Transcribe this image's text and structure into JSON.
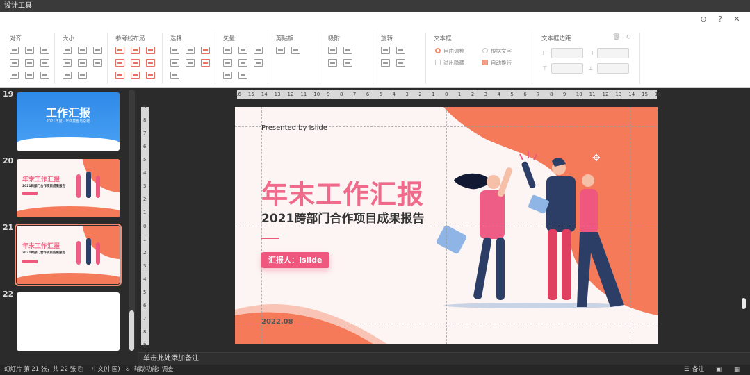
{
  "window": {
    "title": "设计工具"
  },
  "ribbon": {
    "groups": [
      {
        "label": "对齐"
      },
      {
        "label": "大小"
      },
      {
        "label": "参考线布局"
      },
      {
        "label": "选择"
      },
      {
        "label": "矢量"
      },
      {
        "label": "剪贴板"
      },
      {
        "label": "吸附"
      },
      {
        "label": "旋转"
      },
      {
        "label": "文本框"
      },
      {
        "label": "文本框边距"
      }
    ],
    "textbox": {
      "auto_adjust": "自由调整",
      "fit_text": "根据文字",
      "overflow_hide": "溢出隐藏",
      "auto_wrap": "自动换行"
    },
    "icons": {
      "settings": "settings-icon",
      "help": "help-icon",
      "close": "close-icon"
    }
  },
  "thumbnails": [
    {
      "number": "19",
      "title": "工作汇报",
      "subtitle": "2021年度 · 年终复盘与总结"
    },
    {
      "number": "20",
      "title": "年末工作汇报",
      "subtitle": "2021跨部门合作项目成果报告"
    },
    {
      "number": "21",
      "title": "年末工作汇报",
      "subtitle": "2021跨部门合作项目成果报告",
      "selected": true
    },
    {
      "number": "22"
    }
  ],
  "ruler": {
    "h_labels": [
      "16",
      "15",
      "14",
      "13",
      "12",
      "11",
      "10",
      "9",
      "8",
      "7",
      "6",
      "5",
      "4",
      "3",
      "2",
      "1",
      "0",
      "1",
      "2",
      "3",
      "4",
      "5",
      "6",
      "7",
      "8",
      "9",
      "10",
      "11",
      "12",
      "13",
      "14",
      "15",
      "16"
    ],
    "v_labels": [
      "9",
      "8",
      "7",
      "6",
      "5",
      "4",
      "3",
      "2",
      "1",
      "0",
      "1",
      "2",
      "3",
      "4",
      "5",
      "6",
      "7",
      "8",
      "9"
    ]
  },
  "slide": {
    "presented_by": "Presented by Islide",
    "title": "年末工作汇报",
    "subtitle": "2021跨部门合作项目成果报告",
    "reporter": "汇报人：Islide",
    "date": "2022.08",
    "colors": {
      "accent": "#f0577e",
      "coral": "#f57a5a",
      "background": "#fdf5f3"
    }
  },
  "notes": {
    "placeholder": "单击此处添加备注"
  },
  "status": {
    "slide_count": "幻灯片 第 21 张，共 22 张",
    "language": "中文(中国)",
    "accessibility": "辅助功能: 调查",
    "notes": "备注"
  }
}
